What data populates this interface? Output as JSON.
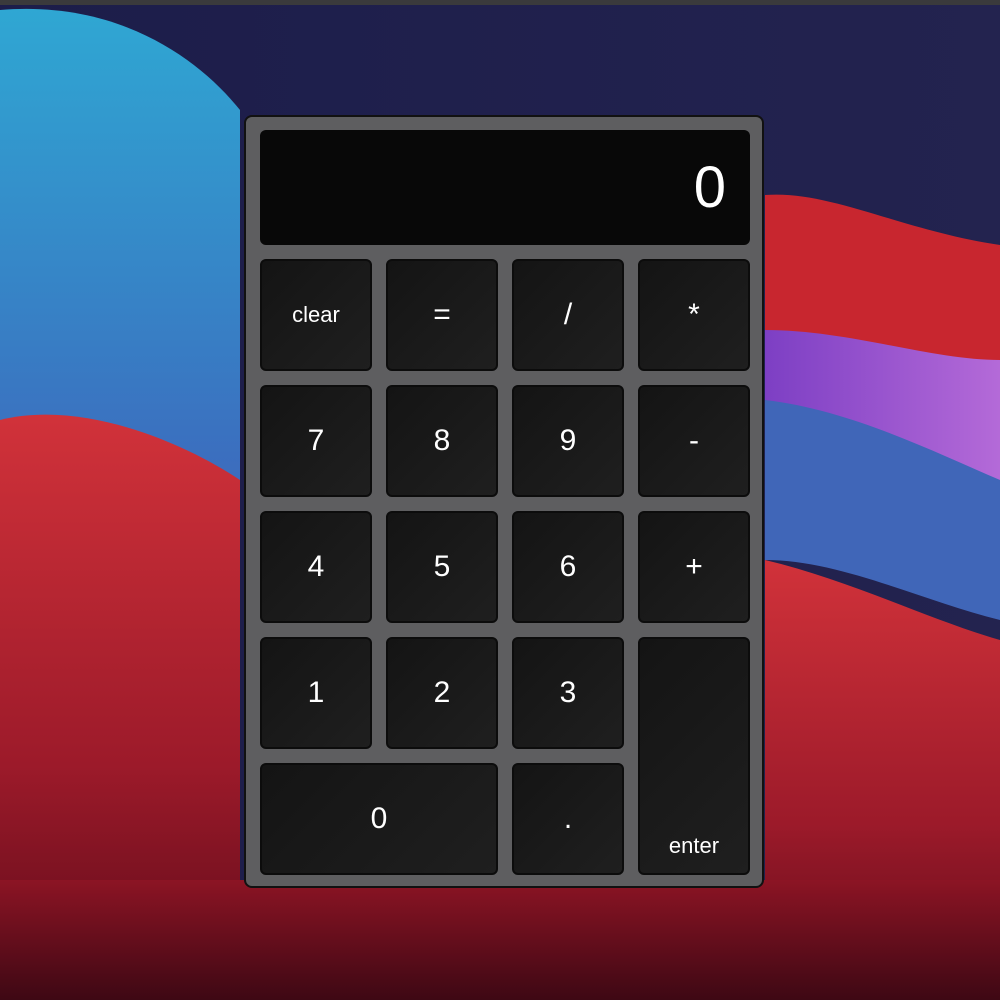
{
  "display": {
    "value": "0"
  },
  "keys": {
    "clear": "clear",
    "equals": "=",
    "divide": "/",
    "multiply": "*",
    "seven": "7",
    "eight": "8",
    "nine": "9",
    "minus": "-",
    "four": "4",
    "five": "5",
    "six": "6",
    "plus": "+",
    "one": "1",
    "two": "2",
    "three": "3",
    "enter": "enter",
    "zero": "0",
    "decimal": "."
  },
  "colors": {
    "body": "#5e5e60",
    "display_bg": "#080808",
    "key_bg": "#1a1a1a",
    "text": "#ffffff"
  }
}
